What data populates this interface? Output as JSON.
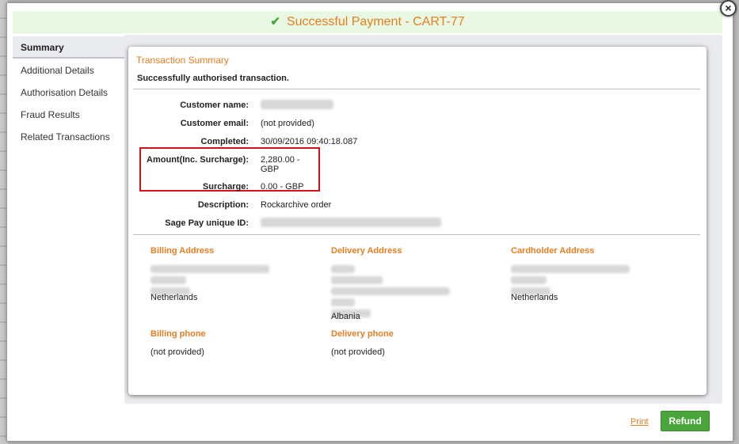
{
  "title": {
    "icon": "check-icon",
    "text": "Successful Payment - CART-77"
  },
  "close_label": "×",
  "sidebar": {
    "items": [
      {
        "label": "Summary",
        "active": true
      },
      {
        "label": "Additional Details",
        "active": false
      },
      {
        "label": "Authorisation Details",
        "active": false
      },
      {
        "label": "Fraud Results",
        "active": false
      },
      {
        "label": "Related Transactions",
        "active": false
      }
    ]
  },
  "summary": {
    "section_title": "Transaction Summary",
    "status_text": "Successfully authorised transaction.",
    "fields": {
      "customer_name": {
        "label": "Customer name:"
      },
      "customer_email": {
        "label": "Customer email:",
        "value": "(not provided)"
      },
      "completed": {
        "label": "Completed:",
        "value": "30/09/2016 09:40:18.087"
      },
      "amount": {
        "label": "Amount(Inc. Surcharge):",
        "value_line1": "2,280.00 -",
        "value_line2": "GBP"
      },
      "surcharge": {
        "label": "Surcharge:",
        "value": "0.00 - GBP"
      },
      "description": {
        "label": "Description:",
        "value": "Rockarchive order"
      },
      "unique_id": {
        "label": "Sage Pay unique ID:"
      }
    }
  },
  "addresses": {
    "billing": {
      "heading": "Billing Address",
      "country": "Netherlands"
    },
    "delivery": {
      "heading": "Delivery Address",
      "country": "Albania"
    },
    "cardholder": {
      "heading": "Cardholder Address",
      "country": "Netherlands"
    },
    "billing_phone": {
      "heading": "Billing phone",
      "value": "(not provided)"
    },
    "delivery_phone": {
      "heading": "Delivery phone",
      "value": "(not provided)"
    }
  },
  "footer": {
    "print_label": "Print",
    "refund_label": "Refund"
  },
  "colors": {
    "accent_orange": "#e67e22",
    "success_green": "#4aa63a",
    "title_bg": "#e9f8e2",
    "highlight_red": "#d0141a"
  }
}
